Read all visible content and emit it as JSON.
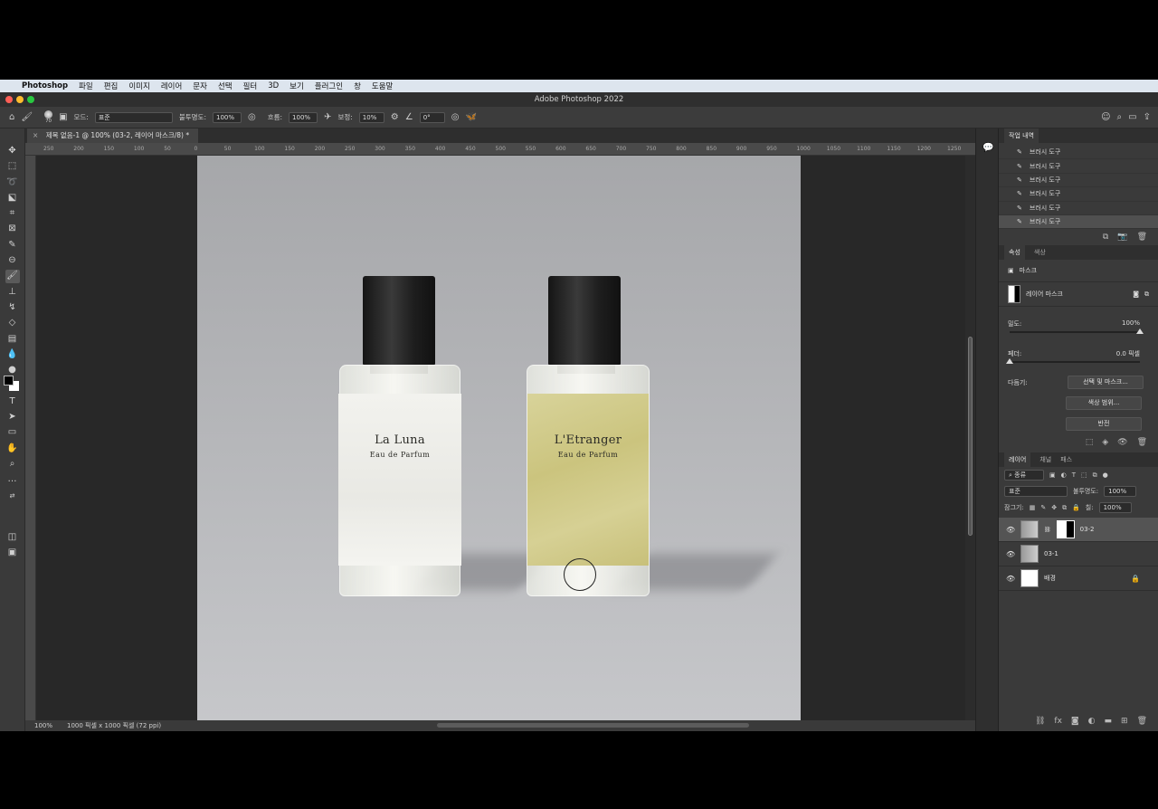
{
  "menubar": {
    "apple": "",
    "items": [
      "Photoshop",
      "파일",
      "편집",
      "이미지",
      "레이어",
      "문자",
      "선택",
      "필터",
      "3D",
      "보기",
      "플러그인",
      "창",
      "도움말"
    ]
  },
  "window": {
    "title": "Adobe Photoshop 2022"
  },
  "options_bar": {
    "brush_size": "70",
    "mode_label": "모드:",
    "mode_value": "표준",
    "opacity_label": "불투명도:",
    "opacity_value": "100%",
    "flow_label": "흐름:",
    "flow_value": "100%",
    "smoothing_label": "보정:",
    "smoothing_value": "10%",
    "angle_value": "0°"
  },
  "document": {
    "tab_title": "제목 없음-1 @ 100% (03-2, 레이어 마스크/8) *",
    "zoom": "100%",
    "doc_info": "1000 픽셀 x 1000 픽셀 (72 ppi)",
    "ruler_ticks": [
      "250",
      "200",
      "150",
      "100",
      "50",
      "0",
      "50",
      "100",
      "150",
      "200",
      "250",
      "300",
      "350",
      "400",
      "450",
      "500",
      "550",
      "600",
      "650",
      "700",
      "750",
      "800",
      "850",
      "900",
      "950",
      "1000",
      "1050",
      "1100",
      "1150",
      "1200",
      "1250"
    ]
  },
  "product_photo": {
    "left_bottle": {
      "name": "La Luna",
      "subtitle": "Eau de Parfum"
    },
    "right_bottle": {
      "name": "L'Etranger",
      "subtitle": "Eau de Parfum"
    }
  },
  "history_panel": {
    "tab": "작업 내역",
    "items": [
      "브러시 도구",
      "브러시 도구",
      "브러시 도구",
      "브러시 도구",
      "브러시 도구",
      "브러시 도구"
    ],
    "selected_index": 5
  },
  "properties_panel": {
    "tabs": [
      "속성",
      "색상"
    ],
    "mask_header": "마스크",
    "layer_mask_label": "레이어 마스크",
    "density_label": "밀도:",
    "density_value": "100%",
    "feather_label": "페더:",
    "feather_value": "0.0 픽셀",
    "refine_label": "다듬기:",
    "btn_select_mask": "선택 및 마스크...",
    "btn_color_range": "색상 범위...",
    "btn_invert": "반전"
  },
  "layers_panel": {
    "tabs": [
      "레이어",
      "채널",
      "패스"
    ],
    "filter_kind": "종류",
    "blend_mode": "표준",
    "opacity_label": "불투명도:",
    "opacity_value": "100%",
    "lock_label": "잠그기:",
    "fill_label": "칠:",
    "fill_value": "100%",
    "layers": [
      {
        "name": "03-2",
        "selected": true
      },
      {
        "name": "03-1",
        "selected": false
      },
      {
        "name": "배경",
        "selected": false
      }
    ]
  }
}
